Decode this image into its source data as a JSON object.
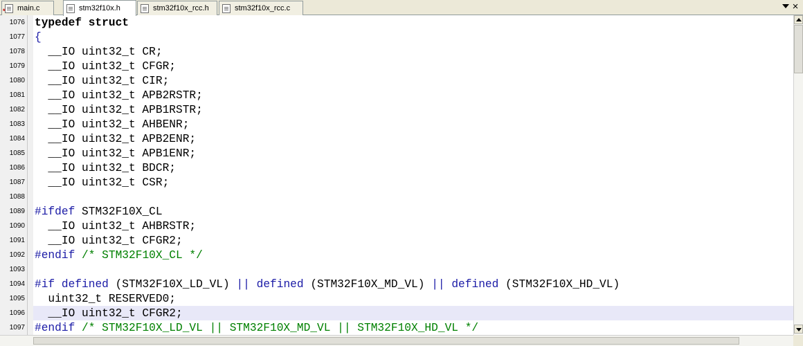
{
  "tabs": [
    {
      "label": "main.c",
      "modified": true,
      "active": false
    },
    {
      "label": "stm32f10x.h",
      "modified": false,
      "active": true
    },
    {
      "label": "stm32f10x_rcc.h",
      "modified": false,
      "active": false
    },
    {
      "label": "stm32f10x_rcc.c",
      "modified": false,
      "active": false
    }
  ],
  "tab_bar": {
    "close_glyph": "×",
    "modified_marker": "*"
  },
  "current_line": "1096",
  "lines": [
    {
      "num": "1076",
      "tokens": [
        {
          "t": "typedef struct",
          "c": "kw"
        }
      ]
    },
    {
      "num": "1077",
      "tokens": [
        {
          "t": "{",
          "c": "br"
        }
      ]
    },
    {
      "num": "1078",
      "tokens": [
        {
          "t": "  __IO uint32_t CR;",
          "c": ""
        }
      ]
    },
    {
      "num": "1079",
      "tokens": [
        {
          "t": "  __IO uint32_t CFGR;",
          "c": ""
        }
      ]
    },
    {
      "num": "1080",
      "tokens": [
        {
          "t": "  __IO uint32_t CIR;",
          "c": ""
        }
      ]
    },
    {
      "num": "1081",
      "tokens": [
        {
          "t": "  __IO uint32_t APB2RSTR;",
          "c": ""
        }
      ]
    },
    {
      "num": "1082",
      "tokens": [
        {
          "t": "  __IO uint32_t APB1RSTR;",
          "c": ""
        }
      ]
    },
    {
      "num": "1083",
      "tokens": [
        {
          "t": "  __IO uint32_t AHBENR;",
          "c": ""
        }
      ]
    },
    {
      "num": "1084",
      "tokens": [
        {
          "t": "  __IO uint32_t APB2ENR;",
          "c": ""
        }
      ]
    },
    {
      "num": "1085",
      "tokens": [
        {
          "t": "  __IO uint32_t APB1ENR;",
          "c": ""
        }
      ]
    },
    {
      "num": "1086",
      "tokens": [
        {
          "t": "  __IO uint32_t BDCR;",
          "c": ""
        }
      ]
    },
    {
      "num": "1087",
      "tokens": [
        {
          "t": "  __IO uint32_t CSR;",
          "c": ""
        }
      ]
    },
    {
      "num": "1088",
      "tokens": []
    },
    {
      "num": "1089",
      "tokens": [
        {
          "t": "#ifdef",
          "c": "pp"
        },
        {
          "t": " STM32F10X_CL",
          "c": ""
        }
      ]
    },
    {
      "num": "1090",
      "tokens": [
        {
          "t": "  __IO uint32_t AHBRSTR;",
          "c": ""
        }
      ]
    },
    {
      "num": "1091",
      "tokens": [
        {
          "t": "  __IO uint32_t CFGR2;",
          "c": ""
        }
      ]
    },
    {
      "num": "1092",
      "tokens": [
        {
          "t": "#endif",
          "c": "pp"
        },
        {
          "t": " /* STM32F10X_CL */",
          "c": "cm"
        }
      ]
    },
    {
      "num": "1093",
      "tokens": []
    },
    {
      "num": "1094",
      "tokens": [
        {
          "t": "#if",
          "c": "pp"
        },
        {
          "t": " ",
          "c": ""
        },
        {
          "t": "defined",
          "c": "bl"
        },
        {
          "t": " (STM32F10X_LD_VL) ",
          "c": ""
        },
        {
          "t": "||",
          "c": "bl"
        },
        {
          "t": " ",
          "c": ""
        },
        {
          "t": "defined",
          "c": "bl"
        },
        {
          "t": " (STM32F10X_MD_VL) ",
          "c": ""
        },
        {
          "t": "||",
          "c": "bl"
        },
        {
          "t": " ",
          "c": ""
        },
        {
          "t": "defined",
          "c": "bl"
        },
        {
          "t": " (STM32F10X_HD_VL)",
          "c": ""
        }
      ]
    },
    {
      "num": "1095",
      "tokens": [
        {
          "t": "  uint32_t RESERVED0;",
          "c": ""
        }
      ]
    },
    {
      "num": "1096",
      "tokens": [
        {
          "t": "  __IO uint32_t CFGR2;",
          "c": ""
        }
      ]
    },
    {
      "num": "1097",
      "tokens": [
        {
          "t": "#endif",
          "c": "pp"
        },
        {
          "t": " /* STM32F10X_LD_VL || STM32F10X_MD_VL || STM32F10X_HD_VL */",
          "c": "cm"
        }
      ]
    }
  ]
}
